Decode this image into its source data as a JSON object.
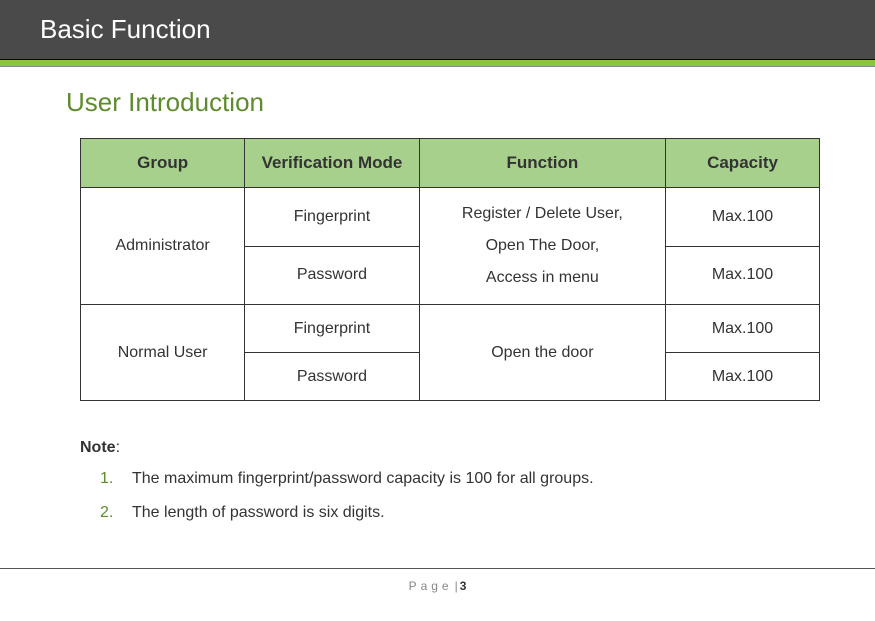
{
  "header": {
    "title": "Basic Function"
  },
  "section": {
    "title": "User Introduction",
    "headers": [
      "Group",
      "Verification Mode",
      "Function",
      "Capacity"
    ],
    "rows": {
      "admin_group": "Administrator",
      "admin_v1": "Fingerprint",
      "admin_v2": "Password",
      "admin_func": "Register / Delete User,\nOpen The Door,\nAccess in menu",
      "admin_cap1": "Max.100",
      "admin_cap2": "Max.100",
      "normal_group": "Normal User",
      "normal_v1": "Fingerprint",
      "normal_v2": "Password",
      "normal_func": "Open the door",
      "normal_cap1": "Max.100",
      "normal_cap2": "Max.100"
    }
  },
  "notes": {
    "label": "Note",
    "items": [
      "The maximum fingerprint/password capacity is 100 for all groups.",
      "The length of password is six digits."
    ]
  },
  "footer": {
    "page_word": "Page",
    "page_num": "3"
  }
}
